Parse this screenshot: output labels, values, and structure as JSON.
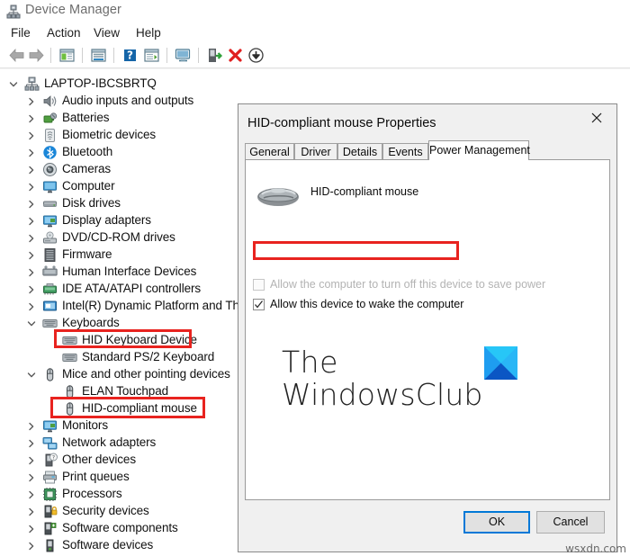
{
  "window": {
    "title": "Device Manager",
    "icon": "device-manager-icon",
    "menu": [
      {
        "label": "File"
      },
      {
        "label": "Action"
      },
      {
        "label": "View"
      },
      {
        "label": "Help"
      }
    ],
    "toolbar": [
      {
        "name": "back-arrow-icon",
        "tip": "Back"
      },
      {
        "name": "forward-arrow-icon",
        "tip": "Forward"
      },
      {
        "name": "show-hide-console-tree-icon",
        "tip": "Show/Hide Console Tree"
      },
      {
        "name": "properties-icon",
        "tip": "Properties"
      },
      {
        "name": "help-icon",
        "tip": "Help"
      },
      {
        "name": "show-hide-action-pane-icon",
        "tip": "Show/Hide Action Pane"
      },
      {
        "name": "scan-for-hardware-changes-icon",
        "tip": "Scan for hardware changes"
      },
      {
        "name": "update-driver-icon",
        "tip": "Update driver"
      },
      {
        "name": "uninstall-device-icon",
        "tip": "Uninstall device"
      },
      {
        "name": "disable-device-icon",
        "tip": "Disable device"
      }
    ]
  },
  "tree": {
    "root": {
      "label": "LAPTOP-IBCSBRTQ",
      "icon": "computer-node-icon",
      "expanded": true
    },
    "items": [
      {
        "label": "Audio inputs and outputs",
        "icon": "speaker-icon",
        "depth": 1,
        "state": "collapsed",
        "highlight": false
      },
      {
        "label": "Batteries",
        "icon": "battery-icon",
        "depth": 1,
        "state": "collapsed",
        "highlight": false
      },
      {
        "label": "Biometric devices",
        "icon": "fingerprint-icon",
        "depth": 1,
        "state": "collapsed",
        "highlight": false
      },
      {
        "label": "Bluetooth",
        "icon": "bluetooth-icon",
        "depth": 1,
        "state": "collapsed",
        "highlight": false
      },
      {
        "label": "Cameras",
        "icon": "camera-icon",
        "depth": 1,
        "state": "collapsed",
        "highlight": false
      },
      {
        "label": "Computer",
        "icon": "monitor-icon",
        "depth": 1,
        "state": "collapsed",
        "highlight": false
      },
      {
        "label": "Disk drives",
        "icon": "disk-icon",
        "depth": 1,
        "state": "collapsed",
        "highlight": false
      },
      {
        "label": "Display adapters",
        "icon": "display-adapter-icon",
        "depth": 1,
        "state": "collapsed",
        "highlight": false
      },
      {
        "label": "DVD/CD-ROM drives",
        "icon": "optical-drive-icon",
        "depth": 1,
        "state": "collapsed",
        "highlight": false
      },
      {
        "label": "Firmware",
        "icon": "firmware-icon",
        "depth": 1,
        "state": "collapsed",
        "highlight": false
      },
      {
        "label": "Human Interface Devices",
        "icon": "hid-icon",
        "depth": 1,
        "state": "collapsed",
        "highlight": false
      },
      {
        "label": "IDE ATA/ATAPI controllers",
        "icon": "ide-controller-icon",
        "depth": 1,
        "state": "collapsed",
        "highlight": false
      },
      {
        "label": "Intel(R) Dynamic Platform and Ther",
        "icon": "intel-platform-icon",
        "depth": 1,
        "state": "collapsed",
        "highlight": false
      },
      {
        "label": "Keyboards",
        "icon": "keyboard-icon",
        "depth": 1,
        "state": "expanded",
        "highlight": false
      },
      {
        "label": "HID Keyboard Device",
        "icon": "keyboard-icon",
        "depth": 2,
        "state": "leaf",
        "highlight": true
      },
      {
        "label": "Standard PS/2 Keyboard",
        "icon": "keyboard-icon",
        "depth": 2,
        "state": "leaf",
        "highlight": false
      },
      {
        "label": "Mice and other pointing devices",
        "icon": "mouse-icon",
        "depth": 1,
        "state": "expanded",
        "highlight": false
      },
      {
        "label": "ELAN Touchpad",
        "icon": "mouse-icon",
        "depth": 2,
        "state": "leaf",
        "highlight": false
      },
      {
        "label": "HID-compliant mouse",
        "icon": "mouse-icon",
        "depth": 2,
        "state": "leaf",
        "highlight": true
      },
      {
        "label": "Monitors",
        "icon": "display-adapter-icon",
        "depth": 1,
        "state": "collapsed",
        "highlight": false
      },
      {
        "label": "Network adapters",
        "icon": "network-icon",
        "depth": 1,
        "state": "collapsed",
        "highlight": false
      },
      {
        "label": "Other devices",
        "icon": "other-device-icon",
        "depth": 1,
        "state": "collapsed",
        "highlight": false
      },
      {
        "label": "Print queues",
        "icon": "printer-icon",
        "depth": 1,
        "state": "collapsed",
        "highlight": false
      },
      {
        "label": "Processors",
        "icon": "processor-icon",
        "depth": 1,
        "state": "collapsed",
        "highlight": false
      },
      {
        "label": "Security devices",
        "icon": "security-icon",
        "depth": 1,
        "state": "collapsed",
        "highlight": false
      },
      {
        "label": "Software components",
        "icon": "software-component-icon",
        "depth": 1,
        "state": "collapsed",
        "highlight": false
      },
      {
        "label": "Software devices",
        "icon": "software-device-icon",
        "depth": 1,
        "state": "collapsed",
        "highlight": false
      }
    ]
  },
  "dialog": {
    "title": "HID-compliant mouse Properties",
    "close_icon": "close-icon",
    "tabs": [
      {
        "label": "General",
        "active": false
      },
      {
        "label": "Driver",
        "active": false
      },
      {
        "label": "Details",
        "active": false
      },
      {
        "label": "Events",
        "active": false
      },
      {
        "label": "Power Management",
        "active": true
      }
    ],
    "device": {
      "name": "HID-compliant mouse",
      "icon": "mouse-device-icon"
    },
    "checkboxes": [
      {
        "label": "Allow the computer to turn off this device to save power",
        "checked": false,
        "disabled": true,
        "highlight": false
      },
      {
        "label": "Allow this device to wake the computer",
        "checked": true,
        "disabled": false,
        "highlight": true
      }
    ],
    "buttons": [
      {
        "label": "OK",
        "default": true
      },
      {
        "label": "Cancel",
        "default": false
      }
    ]
  },
  "watermark": {
    "line1": "The",
    "line2": "WindowsClub",
    "logo_icon": "windowsclub-logo-icon",
    "corner": "wsxdn.com"
  },
  "colors": {
    "accent": "#1a6ea5",
    "highlight_red": "#e8231f",
    "default_button_border": "#0078d7",
    "logo_blue_light": "#29b6f6",
    "logo_blue_dark": "#0b56c4"
  }
}
